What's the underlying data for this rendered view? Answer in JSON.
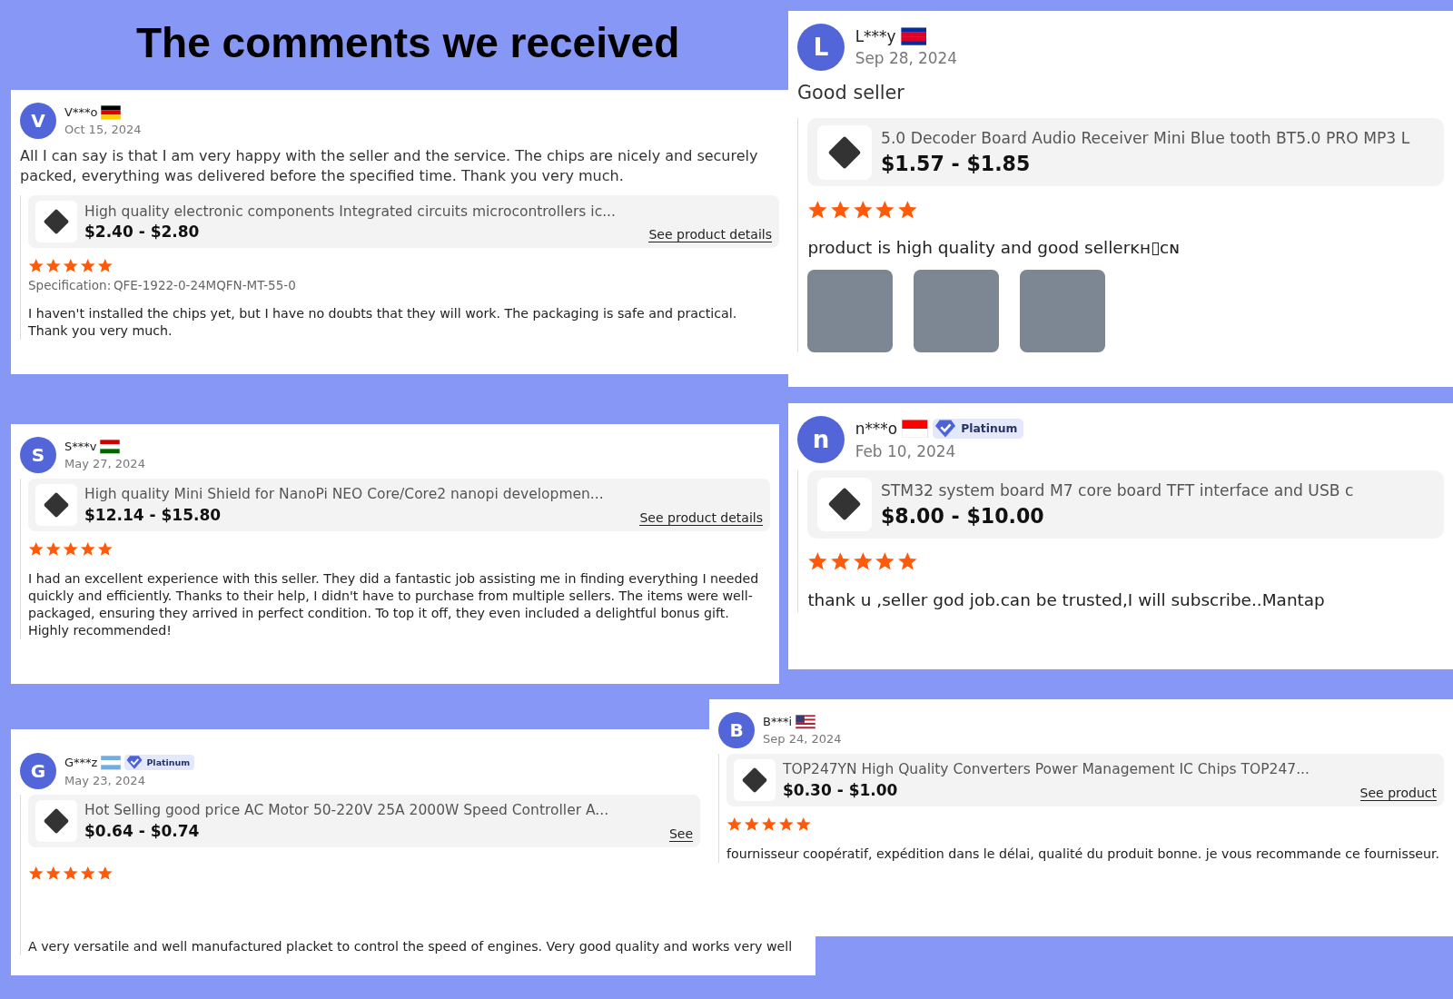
{
  "heading": "The comments we received",
  "reviews": [
    {
      "avatar_letter": "V",
      "name": "V***o",
      "date": "Oct 15, 2024",
      "comment": "All I can say is that I am very happy with the seller and the service. The chips are nicely and securely packed, everything was delivered before the specified time. Thank you very much.",
      "product": {
        "title": "High quality electronic components Integrated circuits microcontrollers ic...",
        "price": "$2.40 - $2.80",
        "link": "See product details"
      },
      "stars": 5,
      "specification": {
        "label": "Specification:",
        "value": "QFE-1922-0-24MQFN-MT-55-0"
      },
      "review_text": "I haven't installed the chips yet, but I have no doubts that they will work. The packaging is safe and practical. Thank you very much."
    },
    {
      "avatar_letter": "L",
      "name": "L***y",
      "date": "Sep 28, 2024",
      "comment": "Good seller",
      "product": {
        "title": "5.0 Decoder Board Audio Receiver Mini Blue tooth BT5.0 PRO MP3 L",
        "price": "$1.57 - $1.85"
      },
      "stars": 5,
      "review_text": "product is high quality and good sellerᴋʜ▯ᴄɴ",
      "photos": [
        {
          "kind": "photo"
        },
        {
          "kind": "photo"
        },
        {
          "kind": "photo"
        }
      ]
    },
    {
      "avatar_letter": "S",
      "name": "S***v",
      "date": "May 27, 2024",
      "product": {
        "title": "High quality Mini Shield for NanoPi NEO Core/Core2 nanopi developmen...",
        "price": "$12.14 - $15.80",
        "link": "See product details"
      },
      "stars": 5,
      "review_text": "I had an excellent experience with this seller. They did a fantastic job assisting me in finding everything I needed quickly and efficiently. Thanks to their help, I didn't have to purchase from multiple sellers. The items were well-packaged, ensuring they arrived in perfect condition. To top it off, they even included a delightful bonus gift. Highly recommended!"
    },
    {
      "avatar_letter": "n",
      "name": "n***o",
      "badge": "Platinum",
      "date": "Feb 10, 2024",
      "product": {
        "title": "STM32 system board M7 core board TFT interface and USB c",
        "price": "$8.00 - $10.00"
      },
      "stars": 5,
      "review_text": "thank u ,seller god job.can be trusted,I will subscribe..Mantap"
    },
    {
      "avatar_letter": "G",
      "name": "G***z",
      "badge": "Platinum",
      "date": "May 23, 2024",
      "product": {
        "title": "Hot Selling good price AC Motor 50-220V 25A 2000W Speed Controller A...",
        "price": "$0.64 - $0.74",
        "link": "See"
      },
      "stars": 5,
      "review_text": "A very versatile and well manufactured placket to control the speed of engines. Very good quality and works very well"
    },
    {
      "avatar_letter": "B",
      "name": "B***i",
      "date": "Sep 24, 2024",
      "product": {
        "title": "TOP247YN High Quality Converters Power Management IC Chips TOP247...",
        "price": "$0.30 - $1.00",
        "link": "See product"
      },
      "stars": 5,
      "review_text": "fournisseur coopératif, expédition dans le délai, qualité du produit bonne. je vous recommande ce fournisseur."
    }
  ]
}
